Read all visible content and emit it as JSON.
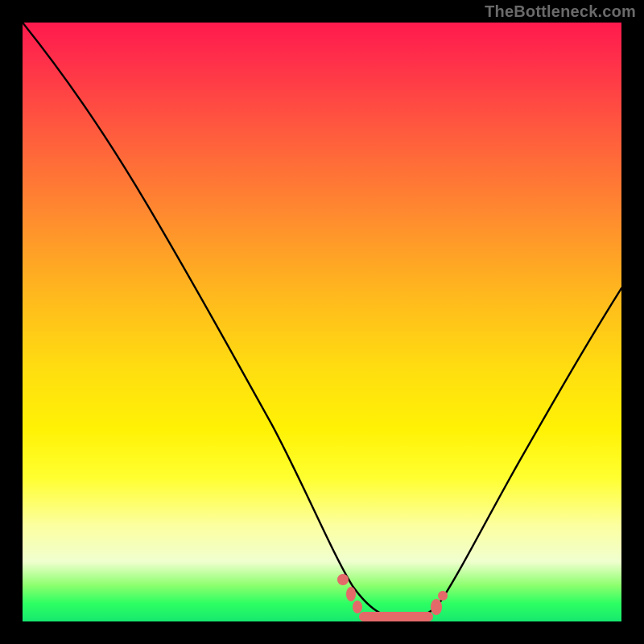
{
  "watermark": "TheBottleneck.com",
  "chart_data": {
    "type": "line",
    "title": "",
    "xlabel": "",
    "ylabel": "",
    "xlim": [
      0,
      100
    ],
    "ylim": [
      0,
      100
    ],
    "grid": false,
    "legend": false,
    "series": [
      {
        "name": "bottleneck-curve",
        "color": "#000000",
        "x": [
          0,
          5,
          10,
          15,
          20,
          25,
          30,
          35,
          40,
          45,
          50,
          52,
          55,
          58,
          60,
          63,
          66,
          68,
          70,
          75,
          80,
          85,
          90,
          95,
          100
        ],
        "y": [
          100,
          92,
          84,
          76,
          68,
          60,
          51,
          42,
          33,
          24,
          14,
          9,
          4,
          2,
          1,
          1,
          1,
          2,
          5,
          15,
          27,
          38,
          48,
          56,
          62
        ]
      },
      {
        "name": "optimal-range",
        "color": "#e46a6a",
        "type": "scatter",
        "x": [
          52,
          54,
          56,
          58,
          60,
          62,
          64,
          66,
          68
        ],
        "y": [
          9,
          5,
          3,
          2,
          1,
          1,
          1,
          1,
          3
        ]
      }
    ],
    "annotations": [
      {
        "text": "TheBottleneck.com",
        "x": 98,
        "y": 100,
        "anchor": "top-right",
        "color": "#6a6a6a"
      }
    ],
    "background_gradient": {
      "direction": "vertical",
      "stops": [
        {
          "pos": 0.0,
          "color": "#ff1a4d"
        },
        {
          "pos": 0.18,
          "color": "#ff5a3e"
        },
        {
          "pos": 0.45,
          "color": "#ffb71e"
        },
        {
          "pos": 0.68,
          "color": "#fff205"
        },
        {
          "pos": 0.9,
          "color": "#f0ffcf"
        },
        {
          "pos": 1.0,
          "color": "#17e86e"
        }
      ]
    }
  }
}
